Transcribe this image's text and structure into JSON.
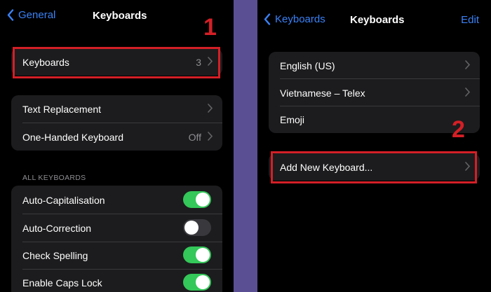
{
  "left": {
    "nav": {
      "back_label": "General",
      "title": "Keyboards"
    },
    "keyboards_row": {
      "label": "Keyboards",
      "value": "3"
    },
    "group2": [
      {
        "label": "Text Replacement",
        "value": ""
      },
      {
        "label": "One-Handed Keyboard",
        "value": "Off"
      }
    ],
    "section_header": "ALL KEYBOARDS",
    "toggles": [
      {
        "label": "Auto-Capitalisation",
        "on": true
      },
      {
        "label": "Auto-Correction",
        "on": false
      },
      {
        "label": "Check Spelling",
        "on": true
      },
      {
        "label": "Enable Caps Lock",
        "on": true
      }
    ]
  },
  "right": {
    "nav": {
      "back_label": "Keyboards",
      "title": "Keyboards",
      "edit_label": "Edit"
    },
    "keyboards": [
      {
        "label": "English (US)"
      },
      {
        "label": "Vietnamese – Telex"
      },
      {
        "label": "Emoji"
      }
    ],
    "add_keyboard": {
      "label": "Add New Keyboard..."
    }
  },
  "annotations": {
    "step1": "1",
    "step2": "2"
  },
  "colors": {
    "accent": "#3a82f7",
    "toggle_on": "#34c759",
    "highlight": "#d41f26",
    "divider_band": "#5a4f93"
  }
}
